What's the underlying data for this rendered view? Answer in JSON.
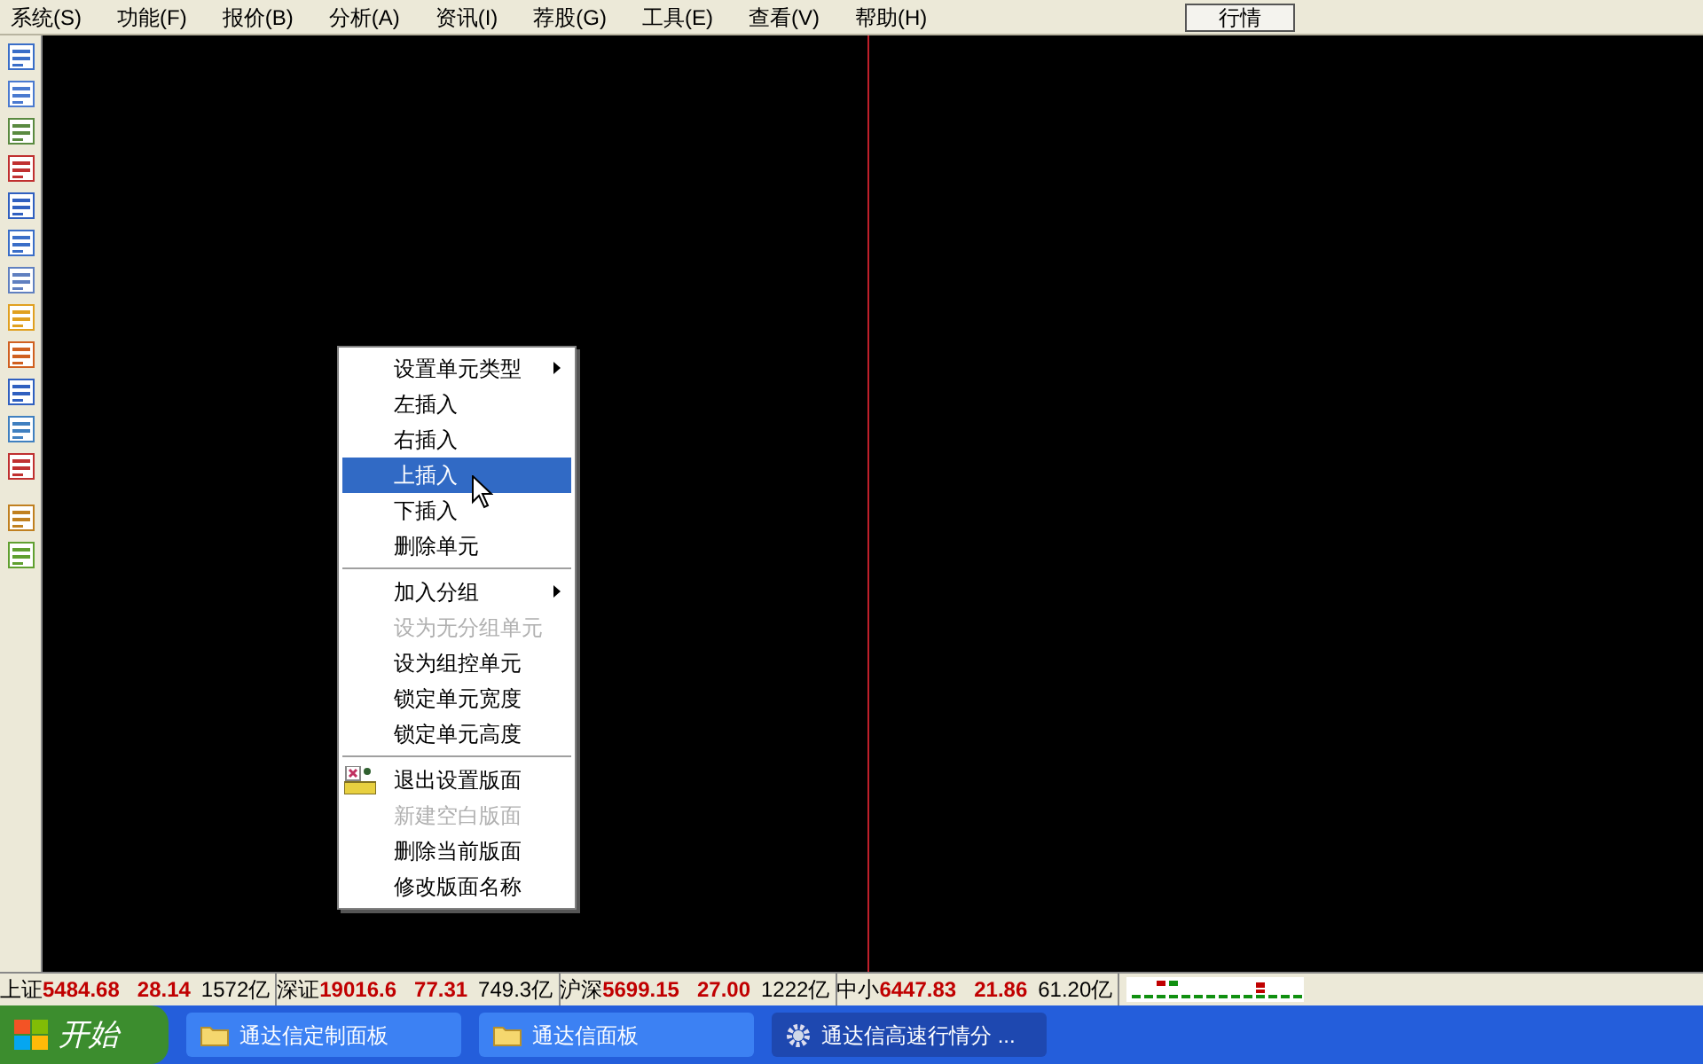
{
  "menu_bar": {
    "items": [
      "系统(S)",
      "功能(F)",
      "报价(B)",
      "分析(A)",
      "资讯(I)",
      "荐股(G)",
      "工具(E)",
      "查看(V)",
      "帮助(H)"
    ],
    "button": "行情"
  },
  "context_menu": {
    "groups": [
      [
        {
          "label": "设置单元类型",
          "submenu": true,
          "selected": false,
          "disabled": false
        },
        {
          "label": "左插入",
          "submenu": false,
          "selected": false,
          "disabled": false
        },
        {
          "label": "右插入",
          "submenu": false,
          "selected": false,
          "disabled": false
        },
        {
          "label": "上插入",
          "submenu": false,
          "selected": true,
          "disabled": false
        },
        {
          "label": "下插入",
          "submenu": false,
          "selected": false,
          "disabled": false
        },
        {
          "label": "删除单元",
          "submenu": false,
          "selected": false,
          "disabled": false
        }
      ],
      [
        {
          "label": "加入分组",
          "submenu": true,
          "selected": false,
          "disabled": false
        },
        {
          "label": "设为无分组单元",
          "submenu": false,
          "selected": false,
          "disabled": true
        },
        {
          "label": "设为组控单元",
          "submenu": false,
          "selected": false,
          "disabled": false
        },
        {
          "label": "锁定单元宽度",
          "submenu": false,
          "selected": false,
          "disabled": false
        },
        {
          "label": "锁定单元高度",
          "submenu": false,
          "selected": false,
          "disabled": false
        }
      ],
      [
        {
          "label": "退出设置版面",
          "submenu": false,
          "selected": false,
          "disabled": false,
          "icon": true
        },
        {
          "label": "新建空白版面",
          "submenu": false,
          "selected": false,
          "disabled": true
        },
        {
          "label": "删除当前版面",
          "submenu": false,
          "selected": false,
          "disabled": false
        },
        {
          "label": "修改版面名称",
          "submenu": false,
          "selected": false,
          "disabled": false
        }
      ]
    ]
  },
  "status_bar": [
    {
      "label": "上证",
      "value": "5484.68",
      "change": "28.14",
      "amount": "1572亿"
    },
    {
      "label": "深证",
      "value": "19016.6",
      "change": "77.31",
      "amount": "749.3亿"
    },
    {
      "label": "沪深",
      "value": "5699.15",
      "change": "27.00",
      "amount": "1222亿"
    },
    {
      "label": "中小",
      "value": "6447.83",
      "change": "21.86",
      "amount": "61.20亿"
    }
  ],
  "taskbar": {
    "start": "开始",
    "tasks": [
      {
        "label": "通达信定制面板",
        "kind": "folder",
        "selected": false
      },
      {
        "label": "通达信面板",
        "kind": "folder",
        "selected": false
      },
      {
        "label": "通达信高速行情分 ...",
        "kind": "gear",
        "selected": true
      }
    ]
  }
}
